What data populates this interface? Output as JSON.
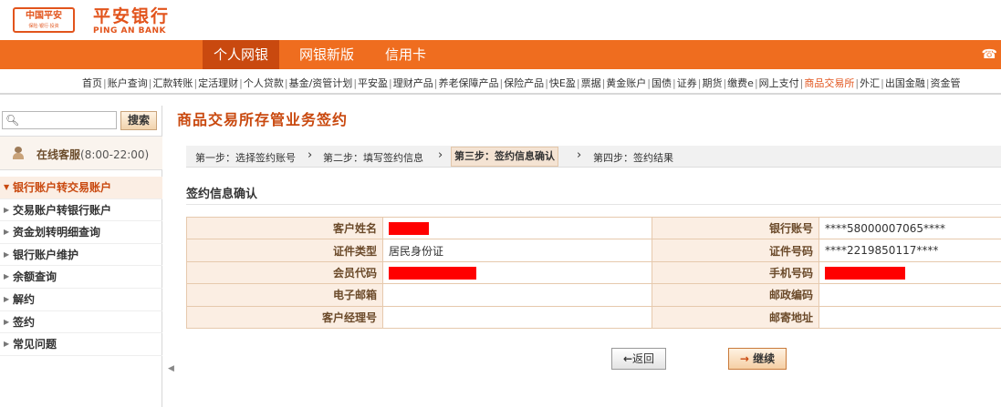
{
  "header": {
    "logo_text": "中国平安",
    "logo_sub": "保险·银行·投资",
    "brand_cn": "平安银行",
    "brand_en": "PING AN BANK"
  },
  "mainnav": {
    "tabs": [
      "个人网银",
      "网银新版",
      "信用卡"
    ],
    "active": "个人网银",
    "phone_icon": "phone-icon"
  },
  "subnav": {
    "items": [
      "首页",
      "账户查询",
      "汇款转账",
      "定活理财",
      "个人贷款",
      "基金/资管计划",
      "平安盈",
      "理财产品",
      "养老保障产品",
      "保险产品",
      "快E盈",
      "票据",
      "黄金账户",
      "国债",
      "证券",
      "期货",
      "缴费e",
      "网上支付",
      "商品交易所",
      "外汇",
      "出国金融",
      "资金管"
    ],
    "active": "商品交易所"
  },
  "sidebar": {
    "search_button": "搜索",
    "search_placeholder": "",
    "service_label": "在线客服",
    "service_hours": "(8:00-22:00)",
    "menu": [
      "银行账户转交易账户",
      "交易账户转银行账户",
      "资金划转明细查询",
      "银行账户维护",
      "余额查询",
      "解约",
      "签约",
      "常见问题"
    ],
    "active_menu": "银行账户转交易账户"
  },
  "main": {
    "title": "商品交易所存管业务签约",
    "steps": [
      "第一步：选择签约账号",
      "第二步：填写签约信息",
      "第三步：签约信息确认",
      "第四步：签约结果"
    ],
    "current_step": 2,
    "section_title": "签约信息确认",
    "rows": [
      {
        "l1": "客户姓名",
        "v1": "",
        "l2": "银行账号",
        "v2": "****58000007065****"
      },
      {
        "l1": "证件类型",
        "v1": "居民身份证",
        "l2": "证件号码",
        "v2": "****2219850117****"
      },
      {
        "l1": "会员代码",
        "v1": "",
        "l2": "手机号码",
        "v2": ""
      },
      {
        "l1": "电子邮箱",
        "v1": "",
        "l2": "邮政编码",
        "v2": ""
      },
      {
        "l1": "客户经理号",
        "v1": "",
        "l2": "邮寄地址",
        "v2": ""
      }
    ],
    "back_label": "返回",
    "next_label": "继续",
    "redaction_color": "#ff0000",
    "accent_color": "#ef6d1f"
  }
}
